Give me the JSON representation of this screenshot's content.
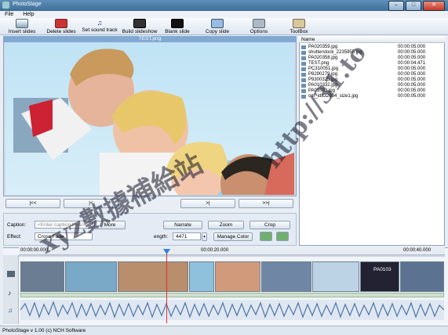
{
  "window": {
    "title": "PhotoStage",
    "min": "–",
    "max": "□",
    "close": "✕"
  },
  "menu": [
    "File",
    "Help"
  ],
  "toolbar": {
    "insert": "Insert slides",
    "delete": "Delete slides",
    "sound": "Set sound track",
    "build": "Build slideshow",
    "blank": "Blank slide",
    "copy": "Copy slide",
    "options": "Options",
    "toolbox": "ToolBox"
  },
  "preview": {
    "title": "TEST.png"
  },
  "nav": {
    "first": "|<<",
    "prev": "|<",
    "next": ">|",
    "last": ">>|"
  },
  "controls": {
    "caption_label": "Caption:",
    "caption_placeholder": "<Enter caption here>",
    "more": "More",
    "narrate": "Narrate",
    "zoom": "Zoom",
    "crop": "Crop",
    "effect_label": "Effect:",
    "effect_value": "Cross Fade",
    "length_label": "ength:",
    "length_value": "4471",
    "manage_color": "Manage Color"
  },
  "filelist": {
    "header_name": "Name",
    "rows": [
      {
        "name": "PA020359.jpg",
        "duration": "00:00:05.000"
      },
      {
        "name": "shutterstock_2235955.jpg",
        "duration": "00:00:05.000"
      },
      {
        "name": "PA020358.jpg",
        "duration": "00:00:05.000"
      },
      {
        "name": "TEST.png",
        "duration": "00:00:04.471"
      },
      {
        "name": "PC310051.jpg",
        "duration": "00:00:05.000"
      },
      {
        "name": "P8290279.jpg",
        "duration": "00:00:05.000"
      },
      {
        "name": "P9300325.jpg",
        "duration": "00:00:05.000"
      },
      {
        "name": "PA010332.jpg",
        "duration": "00:00:05.000"
      },
      {
        "name": "PA01033.jpg",
        "duration": "00:00:05.000"
      },
      {
        "name": "om_id332994_size1.jpg",
        "duration": "00:00:05.000"
      }
    ]
  },
  "timeline": {
    "marks": [
      "00:00:00.000",
      "00:00:20.000",
      "00:00:40.000"
    ],
    "thumb_label": "PA0103"
  },
  "status": "PhotoStage v 1.00 (c) NCH Software",
  "watermark": {
    "left": "xyz數據補給站",
    "right": "http://31.to"
  },
  "colors": {
    "accent": "#7fa9d3",
    "playhead": "#3a7fd8"
  }
}
